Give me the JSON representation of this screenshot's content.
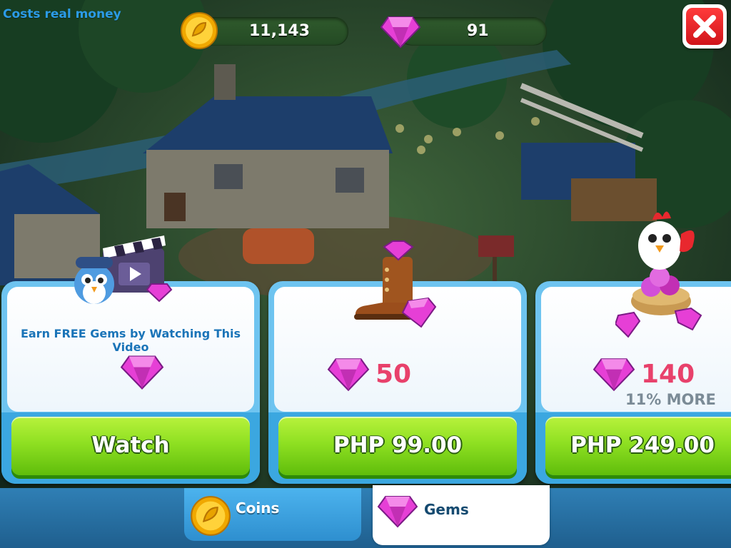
{
  "top_bar": {
    "warning_text": "Costs real money",
    "coins_value": "11,143",
    "gems_value": "91",
    "close_icon": "close-x-icon"
  },
  "offers": [
    {
      "id": "video",
      "description": "Earn FREE Gems by Watching This Video",
      "button_label": "Watch",
      "icon": "gem-icon"
    },
    {
      "id": "gems-50",
      "amount": "50",
      "button_label": "PHP 99.00",
      "icon": "boot-gem-icon"
    },
    {
      "id": "gems-140",
      "amount": "140",
      "bonus_text": "11% MORE",
      "button_label": "PHP 249.00",
      "icon": "chicken-gem-nest-icon"
    }
  ],
  "tabs": [
    {
      "label": "Coins",
      "icon": "coin-icon",
      "selected": false
    },
    {
      "label": "Gems",
      "icon": "gem-icon",
      "selected": true
    }
  ],
  "colors": {
    "accent_blue": "#3ba7e0",
    "button_green": "#8fe022",
    "gem_pink": "#e8416b",
    "close_red": "#e02020"
  }
}
